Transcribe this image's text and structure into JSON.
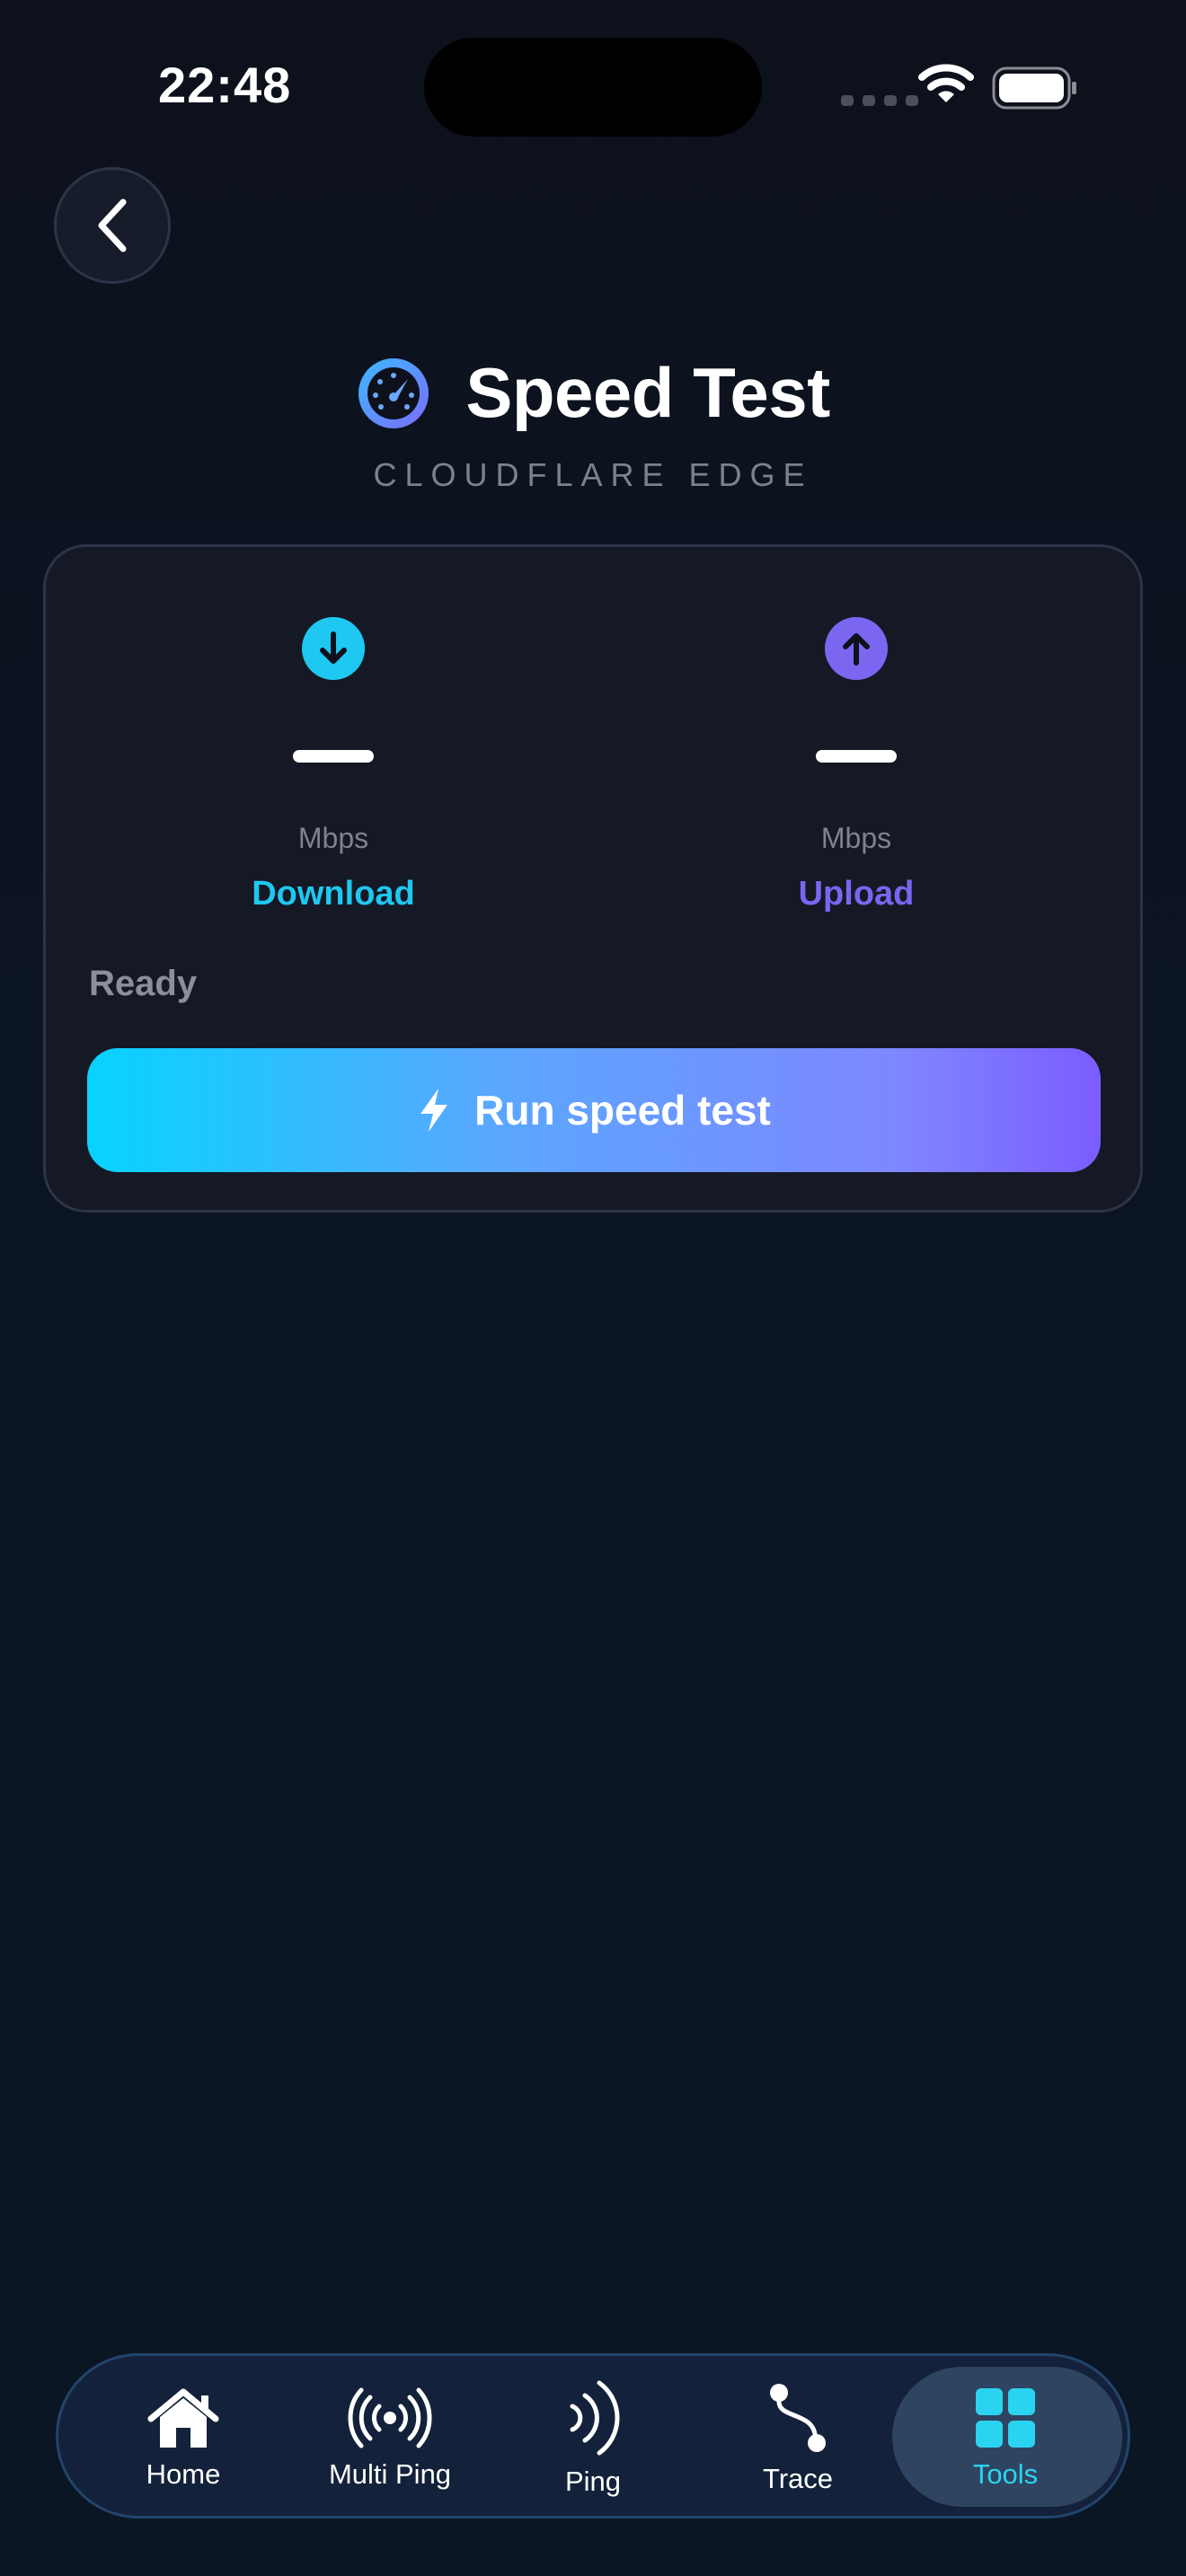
{
  "status_bar": {
    "time": "22:48"
  },
  "header": {
    "title": "Speed Test",
    "subtitle": "CLOUDFLARE EDGE",
    "title_icon": "speedometer-icon",
    "back_icon": "chevron-left-icon"
  },
  "card": {
    "download": {
      "value": "—",
      "unit": "Mbps",
      "label": "Download",
      "icon": "arrow-down-circle-icon",
      "color": "#1ec8f0"
    },
    "upload": {
      "value": "—",
      "unit": "Mbps",
      "label": "Upload",
      "icon": "arrow-up-circle-icon",
      "color": "#7b66f2"
    },
    "status": "Ready",
    "run_button": {
      "label": "Run speed test",
      "icon": "bolt-icon"
    }
  },
  "tab_bar": {
    "active": "Tools",
    "active_color": "#2ad4f0",
    "items": [
      {
        "label": "Home",
        "icon": "house-icon"
      },
      {
        "label": "Multi Ping",
        "icon": "antenna-broadcast-icon"
      },
      {
        "label": "Ping",
        "icon": "wave-signal-icon"
      },
      {
        "label": "Trace",
        "icon": "route-icon"
      },
      {
        "label": "Tools",
        "icon": "grid-icon"
      }
    ]
  }
}
